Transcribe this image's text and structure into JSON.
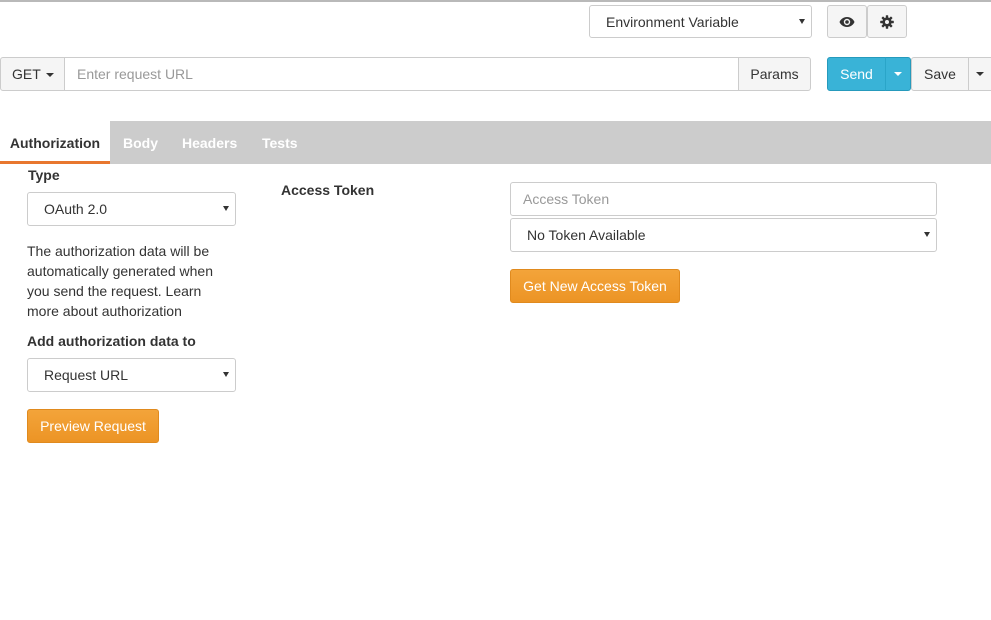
{
  "environment": {
    "selected": "Environment Variable",
    "icons": [
      "eye-icon",
      "gear-icon"
    ]
  },
  "request": {
    "method": "GET",
    "url_placeholder": "Enter request URL",
    "params_label": "Params",
    "send_label": "Send",
    "save_label": "Save"
  },
  "tabs": [
    {
      "label": "Authorization",
      "active": true
    },
    {
      "label": "Body",
      "active": false
    },
    {
      "label": "Headers",
      "active": false
    },
    {
      "label": "Tests",
      "active": false
    }
  ],
  "auth": {
    "type_label": "Type",
    "type_value": "OAuth 2.0",
    "description": "The authorization data will be automatically generated when you send the request. Learn more about authorization",
    "add_to_label": "Add authorization data to",
    "add_to_value": "Request URL",
    "preview_label": "Preview Request",
    "access_token_label": "Access Token",
    "access_token_placeholder": "Access Token",
    "token_select_value": "No Token Available",
    "get_new_token_label": "Get New Access Token"
  },
  "colors": {
    "accent_orange": "#ec9425",
    "send_blue": "#39b3d7",
    "tab_bar": "#cccccc",
    "active_tab_underline": "#e8772e"
  }
}
